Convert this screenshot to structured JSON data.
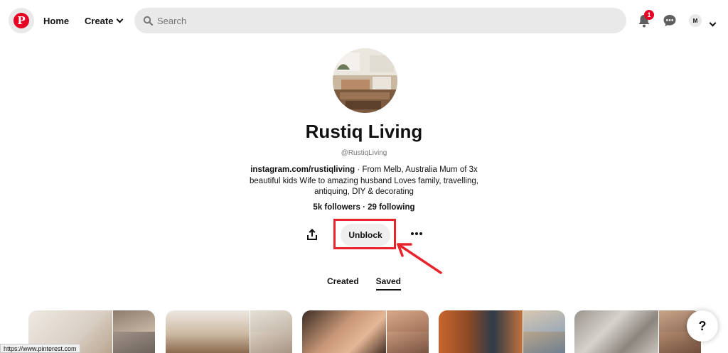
{
  "header": {
    "logo_letter": "P",
    "home_label": "Home",
    "create_label": "Create",
    "search_placeholder": "Search",
    "notification_count": "1",
    "account_initial": "M",
    "logo_color": "#e60023"
  },
  "profile": {
    "name": "Rustiq Living",
    "handle": "@RustiqLiving",
    "bio_link": "instagram.com/rustiqliving",
    "bio_text": " · From Melb, Australia Mum of 3x beautiful kids Wife to amazing husband Loves family, travelling, antiquing, DIY & decorating",
    "stats": "5k followers · 29 following"
  },
  "actions": {
    "unblock_label": "Unblock",
    "highlight_color": "#e8232c"
  },
  "tabs": [
    {
      "label": "Created",
      "active": false
    },
    {
      "label": "Saved",
      "active": true
    }
  ],
  "help_label": "?",
  "status_url": "https://www.pinterest.com"
}
